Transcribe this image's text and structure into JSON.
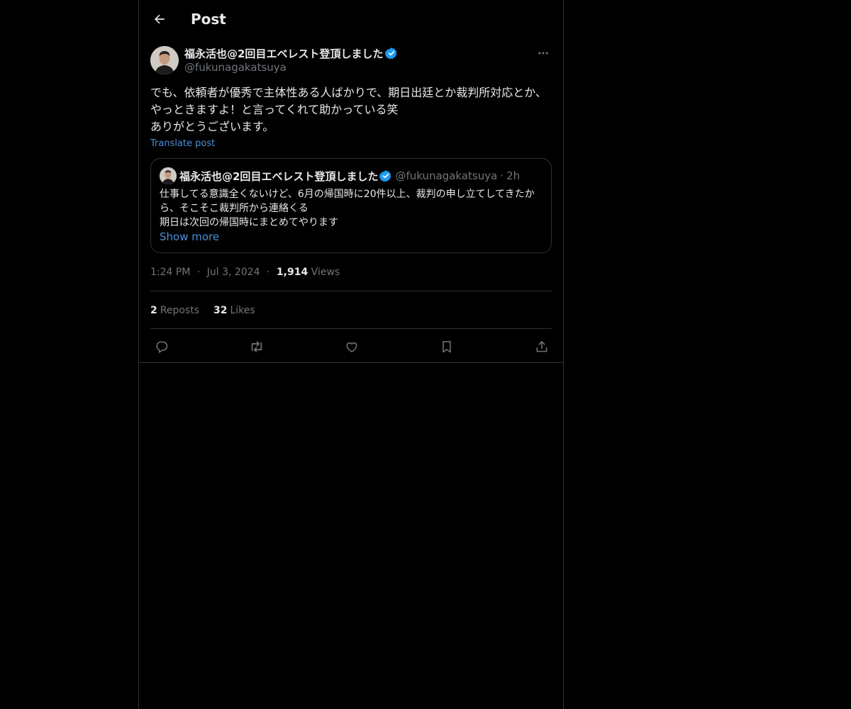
{
  "header": {
    "title": "Post",
    "back_icon": "arrow-left-icon"
  },
  "post": {
    "author": {
      "name": "福永活也@2回目エベレスト登頂しました",
      "handle": "@fukunagakatsuya",
      "verified": true,
      "verified_color": "#1d9bf0"
    },
    "text": "でも、依頼者が優秀で主体性ある人ばかりで、期日出廷とか裁判所対応とか、やっときますよ！と言ってくれて助かっている笑\nありがとうございます。",
    "translate_label": "Translate post",
    "quote": {
      "name": "福永活也@2回目エベレスト登頂しました",
      "handle": "@fukunagakatsuya",
      "dot": "·",
      "time": "2h",
      "text": "仕事してる意識全くないけど、6月の帰国時に20件以上、裁判の申し立てしてきたから、そこそこ裁判所から連絡くる\n期日は次回の帰国時にまとめてやります",
      "show_more": "Show more"
    },
    "meta": {
      "time": "1:24 PM",
      "dot1": "·",
      "date": "Jul 3, 2024",
      "dot2": "·",
      "views_count": "1,914",
      "views_label": "Views"
    },
    "stats": {
      "reposts_count": "2",
      "reposts_label": "Reposts",
      "likes_count": "32",
      "likes_label": "Likes"
    },
    "actions": [
      "reply-icon",
      "repost-icon",
      "like-icon",
      "bookmark-icon",
      "share-icon"
    ]
  },
  "colors": {
    "background": "#000000",
    "text": "#e7e9ea",
    "muted": "#71767b",
    "link": "#4a90d9",
    "border": "#2f3336"
  }
}
